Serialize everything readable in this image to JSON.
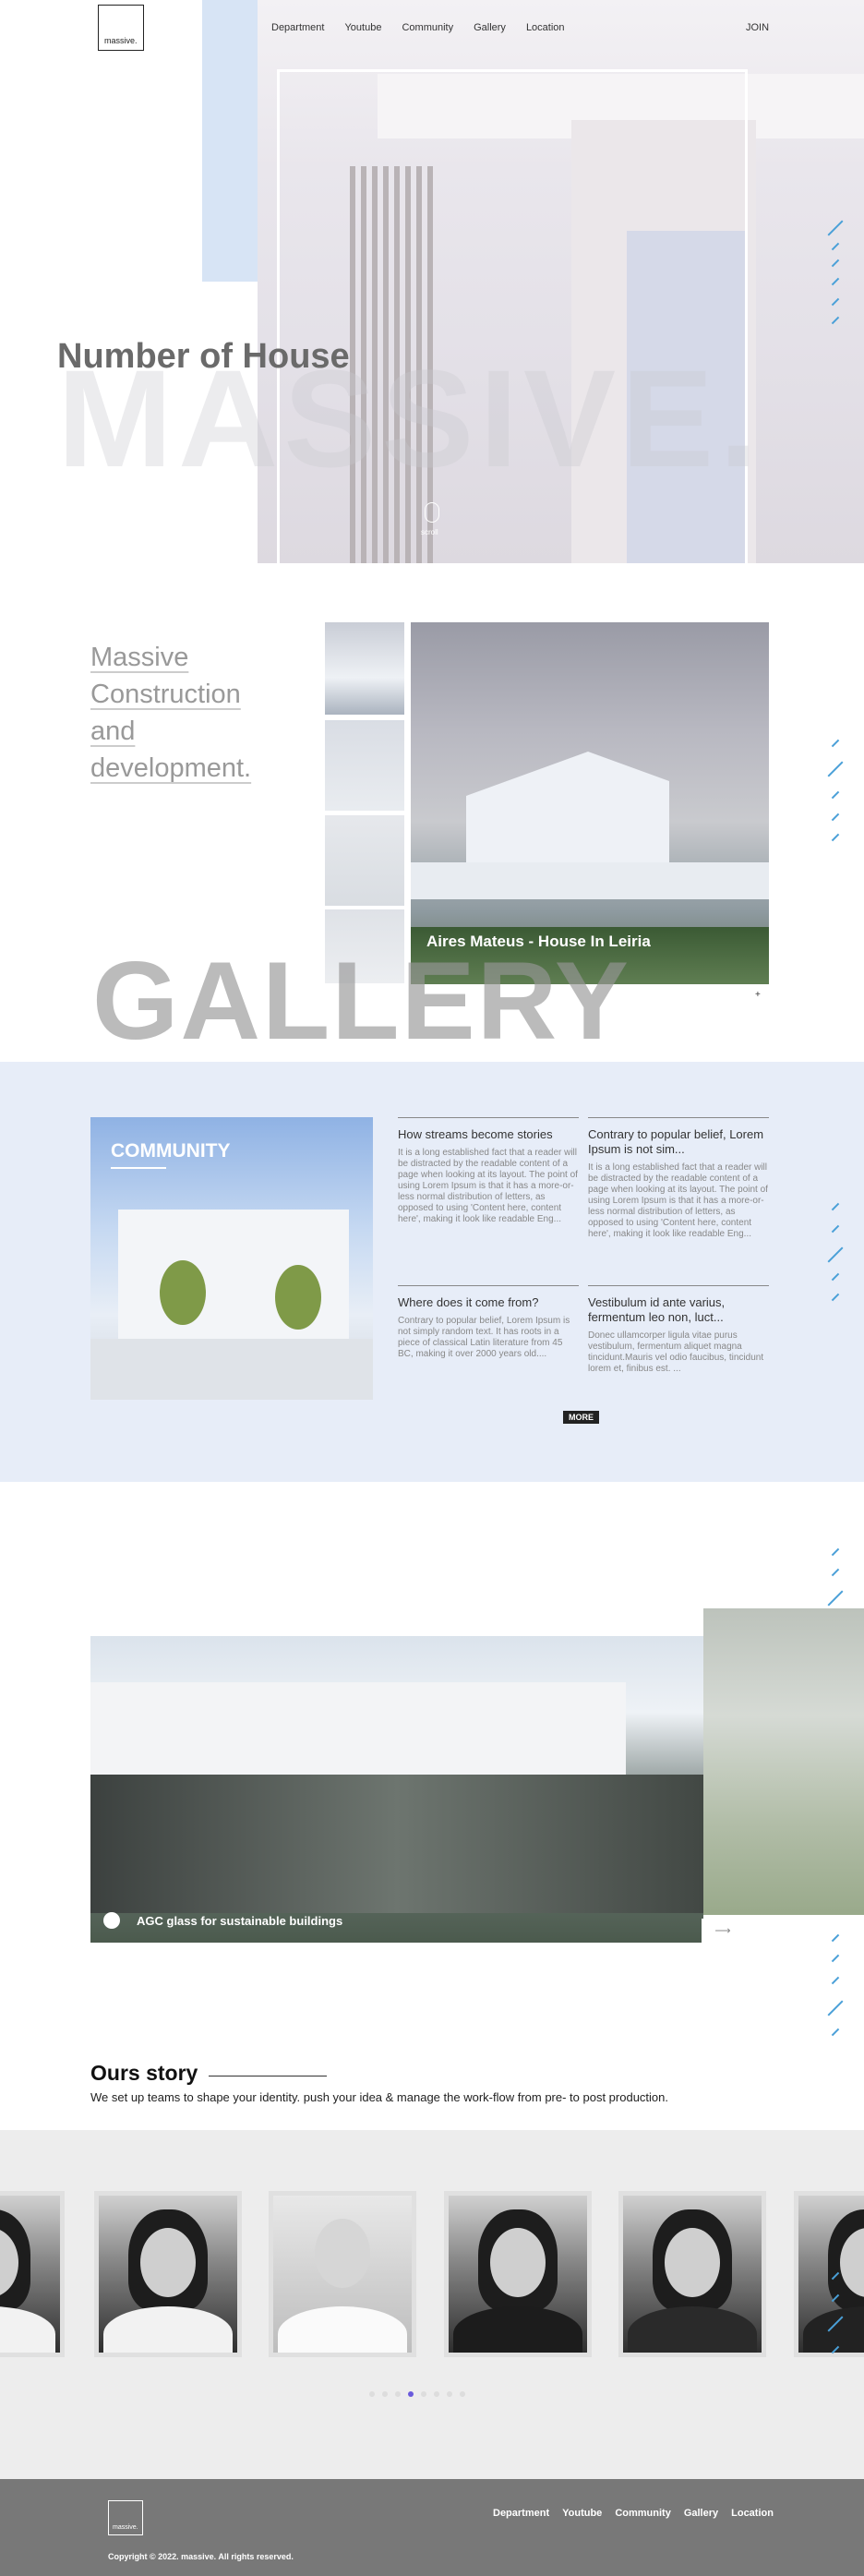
{
  "header": {
    "logo_text": "massive.",
    "nav": [
      "Department",
      "Youtube",
      "Community",
      "Gallery",
      "Location"
    ],
    "join_label": "JOIN"
  },
  "hero": {
    "title": "Number of House",
    "background_word": "MASSIVE.",
    "scroll_label": "scroll"
  },
  "gallery": {
    "heading_lines": [
      "Massive",
      "Construction",
      "and",
      "development."
    ],
    "caption": "Aires Mateus - House In Leiria",
    "plus": "+",
    "background_word": "GALLERY"
  },
  "community": {
    "title": "COMMUNITY",
    "cards": [
      {
        "title": "How streams become stories",
        "text": "It is a long established fact that a reader will be distracted by the readable content of a page when looking at its layout. The point of using Lorem Ipsum is that it has a more-or-less normal distribution of letters, as opposed to using 'Content here, content here', making it look like readable Eng..."
      },
      {
        "title": "Contrary to popular belief, Lorem Ipsum is not sim...",
        "text": "It is a long established fact that a reader will be distracted by the readable content of a page when looking at its layout. The point of using Lorem Ipsum is that it has a more-or-less normal distribution of letters, as opposed to using 'Content here, content here', making it look like readable Eng..."
      },
      {
        "title": "Where does it come from?",
        "text": "Contrary to popular belief, Lorem Ipsum is not simply random text. It has roots in a piece of classical Latin literature from 45 BC, making it over 2000 years old...."
      },
      {
        "title": "Vestibulum id ante varius, fermentum leo non, luct...",
        "text": "Donec ullamcorper ligula vitae purus vestibulum, fermentum aliquet magna tincidunt.Mauris vel odio faucibus, tincidunt lorem et, finibus est. ..."
      }
    ],
    "more_label": "MORE"
  },
  "project": {
    "caption": "AGC glass for sustainable buildings",
    "arrow": "⟶"
  },
  "story": {
    "title": "Ours story",
    "text": "We set up teams to shape your identity. push your idea & manage the work-flow from pre- to post production."
  },
  "team": {
    "dots_total": 8,
    "active_dot": 3
  },
  "footer": {
    "logo_text": "massive.",
    "nav": [
      "Department",
      "Youtube",
      "Community",
      "Gallery",
      "Location"
    ],
    "copyright": "Copyright © 2022. massive. All rights reserved."
  },
  "colors": {
    "accent_blue": "#4aa0d8",
    "community_bg": "#e7edf8",
    "footer_bg": "#787878",
    "active_dot": "#6a5adc"
  }
}
